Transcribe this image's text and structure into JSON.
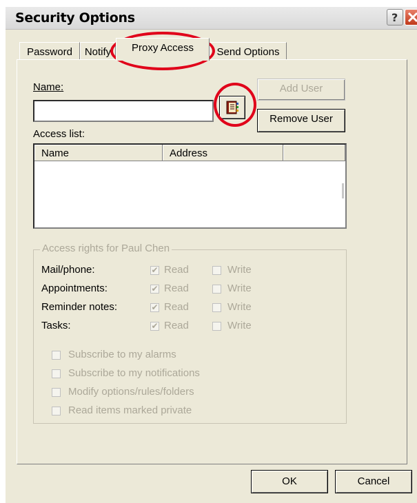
{
  "window": {
    "title": "Security Options"
  },
  "tabs": [
    {
      "label": "Password"
    },
    {
      "label": "Notify"
    },
    {
      "label": "Proxy Access"
    },
    {
      "label": "Send Options"
    }
  ],
  "proxy": {
    "name_label": "Name:",
    "name_value": "",
    "add_user_label": "Add User",
    "remove_user_label": "Remove User",
    "access_list_label": "Access list:",
    "columns": [
      "Name",
      "Address"
    ],
    "rows": []
  },
  "rights": {
    "group_title": "Access rights for Paul Chen",
    "rows": [
      {
        "label": "Mail/phone:",
        "read": "Read",
        "write": "Write",
        "read_checked": true,
        "write_checked": false
      },
      {
        "label": "Appointments:",
        "read": "Read",
        "write": "Write",
        "read_checked": true,
        "write_checked": false
      },
      {
        "label": "Reminder notes:",
        "read": "Read",
        "write": "Write",
        "read_checked": true,
        "write_checked": false
      },
      {
        "label": "Tasks:",
        "read": "Read",
        "write": "Write",
        "read_checked": true,
        "write_checked": false
      }
    ],
    "options": [
      {
        "label": "Subscribe to my alarms",
        "checked": false
      },
      {
        "label": "Subscribe to my notifications",
        "checked": false
      },
      {
        "label": "Modify options/rules/folders",
        "checked": false
      },
      {
        "label": "Read items marked private",
        "checked": false
      }
    ]
  },
  "footer": {
    "ok_label": "OK",
    "cancel_label": "Cancel"
  },
  "icons": {
    "help": "help-icon",
    "close": "close-icon",
    "address_book": "address-book-icon"
  },
  "colors": {
    "annotation": "#e0001a",
    "title_close": "#c0391b"
  }
}
